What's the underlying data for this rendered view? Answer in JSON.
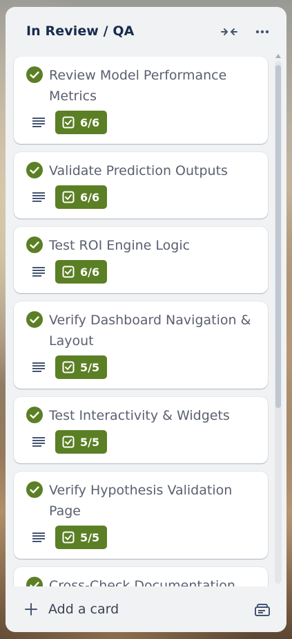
{
  "list": {
    "title": "In Review / QA",
    "add_card_label": "Add a card",
    "header_icons": [
      "collapse-icon",
      "more-icon"
    ],
    "footer_icons": [
      "plus-icon",
      "card-template-icon"
    ]
  },
  "colors": {
    "list_background": "#f1f2f4",
    "complete_green": "#5b7f24",
    "check_circle": "#5b7f24",
    "title_text": "#172b4d",
    "card_text": "#5b6070"
  },
  "cards": [
    {
      "title": "Review Model Performance Metrics",
      "checklist": "6/6",
      "complete": true,
      "has_description": true
    },
    {
      "title": "Validate Prediction Outputs",
      "checklist": "6/6",
      "complete": true,
      "has_description": true
    },
    {
      "title": "Test ROI Engine Logic",
      "checklist": "6/6",
      "complete": true,
      "has_description": true
    },
    {
      "title": "Verify Dashboard Navigation & Layout",
      "checklist": "5/5",
      "complete": true,
      "has_description": true
    },
    {
      "title": "Test Interactivity & Widgets",
      "checklist": "5/5",
      "complete": true,
      "has_description": true
    },
    {
      "title": "Verify Hypothesis Validation Page",
      "checklist": "5/5",
      "complete": true,
      "has_description": true
    },
    {
      "title": "Cross-Check Documentation",
      "checklist": "",
      "complete": true,
      "has_description": false
    }
  ]
}
